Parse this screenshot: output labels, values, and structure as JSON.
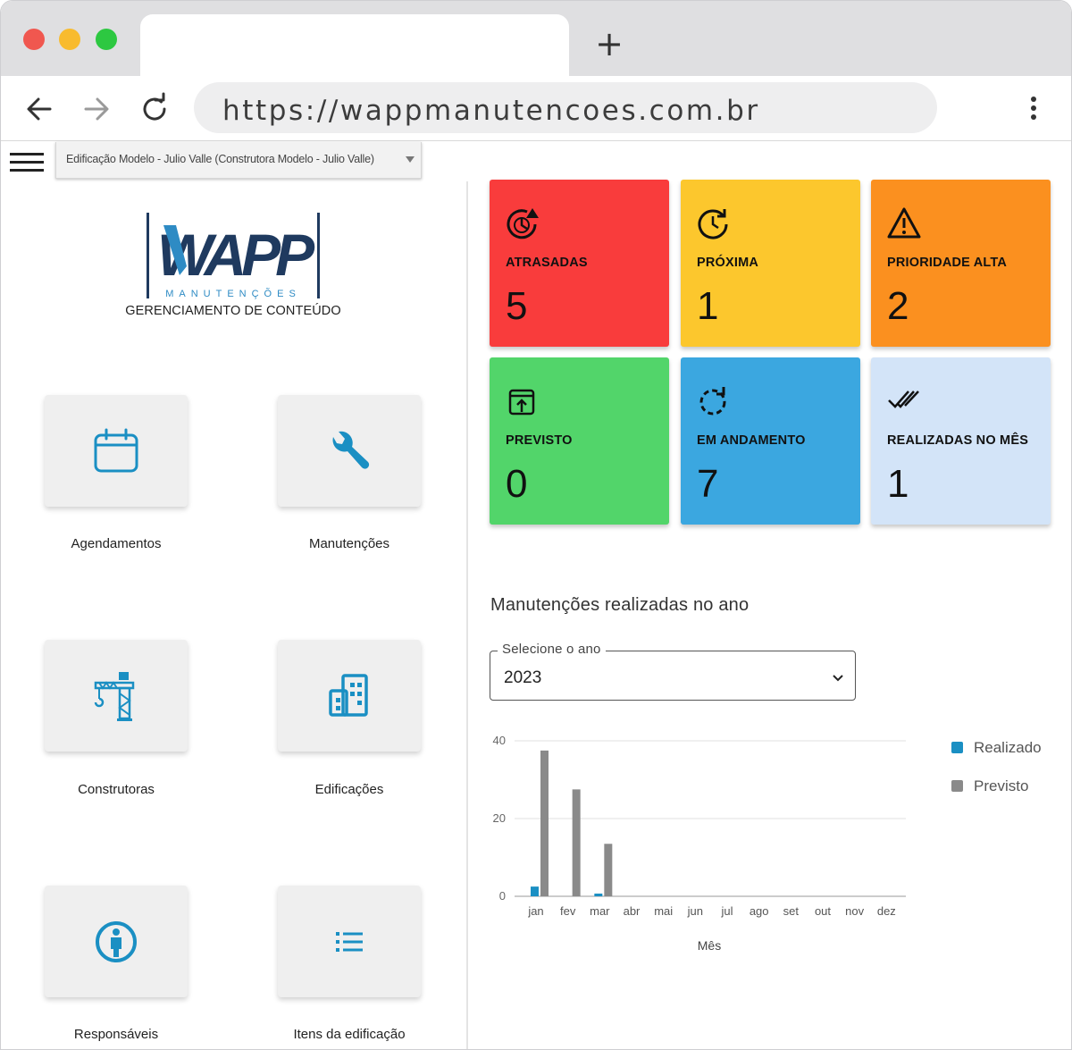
{
  "browser": {
    "url": "https://wappmanutencoes.com.br",
    "new_tab_symbol": "+"
  },
  "header": {
    "building_select": "Edificação Modelo - Julio Valle (Construtora Modelo - Julio Valle)"
  },
  "logo": {
    "brand": "WAPP",
    "tagline": "MANUTENÇÕES",
    "subtitle": "GERENCIAMENTO DE CONTEÚDO"
  },
  "menu": [
    {
      "label": "Agendamentos",
      "icon": "calendar-icon"
    },
    {
      "label": "Manutenções",
      "icon": "wrench-icon"
    },
    {
      "label": "Construtoras",
      "icon": "crane-icon"
    },
    {
      "label": "Edificações",
      "icon": "building-icon"
    },
    {
      "label": "Responsáveis",
      "icon": "person-icon"
    },
    {
      "label": "Itens da edificação",
      "icon": "list-icon"
    }
  ],
  "cards": [
    {
      "label": "ATRASADAS",
      "value": "5",
      "bg": "#f93c3c",
      "fg": "#111111",
      "icon": "clock-alert-icon"
    },
    {
      "label": "PRÓXIMA",
      "value": "1",
      "bg": "#fcc72d",
      "fg": "#111111",
      "icon": "clock-forward-icon"
    },
    {
      "label": "PRIORIDADE ALTA",
      "value": "2",
      "bg": "#fb901f",
      "fg": "#111111",
      "icon": "warning-icon"
    },
    {
      "label": "PREVISTO",
      "value": "0",
      "bg": "#52d56a",
      "fg": "#111111",
      "icon": "calendar-upload-icon"
    },
    {
      "label": "EM ANDAMENTO",
      "value": "7",
      "bg": "#3ba7e0",
      "fg": "#111111",
      "icon": "sync-dashed-icon"
    },
    {
      "label": "REALIZADAS NO MÊS",
      "value": "1",
      "bg": "#d3e4f8",
      "fg": "#111111",
      "icon": "double-check-icon"
    }
  ],
  "chart_section": {
    "title": "Manutenções realizadas no ano",
    "year_label": "Selecione o ano",
    "year_value": "2023"
  },
  "chart_data": {
    "type": "bar",
    "categories": [
      "jan",
      "fev",
      "mar",
      "abr",
      "mai",
      "jun",
      "jul",
      "ago",
      "set",
      "out",
      "nov",
      "dez"
    ],
    "series": [
      {
        "name": "Realizado",
        "color": "#1a8fc3",
        "values": [
          2.5,
          0,
          0.7,
          0,
          0,
          0,
          0,
          0,
          0,
          0,
          0,
          0
        ]
      },
      {
        "name": "Previsto",
        "color": "#8a8a8a",
        "values": [
          37.5,
          27.5,
          13.5,
          0,
          0,
          0,
          0,
          0,
          0,
          0,
          0,
          0
        ]
      }
    ],
    "xlabel": "Mês",
    "ylabel": "",
    "yticks": [
      0,
      20,
      40
    ],
    "ylim": [
      0,
      40
    ],
    "grid": true,
    "legend": "right"
  }
}
